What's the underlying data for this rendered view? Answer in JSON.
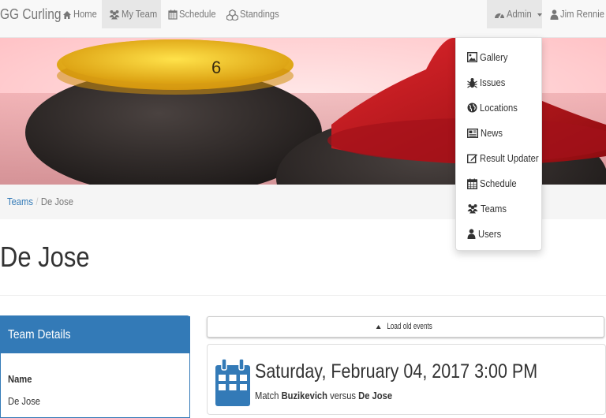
{
  "navbar": {
    "brand": "GG Curling",
    "items": [
      {
        "label": "Home",
        "icon": "home-icon"
      },
      {
        "label": "My Team",
        "icon": "users-icon",
        "active": true
      },
      {
        "label": "Schedule",
        "icon": "calendar-icon"
      },
      {
        "label": "Standings",
        "icon": "cubes-icon"
      }
    ],
    "admin": {
      "label": "Admin",
      "icon": "tachometer-icon"
    },
    "user": {
      "label": "Jim Rennie",
      "icon": "user-icon"
    }
  },
  "admin_menu": {
    "items": [
      {
        "label": "Gallery",
        "icon": "picture-icon"
      },
      {
        "label": "Issues",
        "icon": "bug-icon"
      },
      {
        "label": "Locations",
        "icon": "globe-icon"
      },
      {
        "label": "News",
        "icon": "newspaper-icon"
      },
      {
        "label": "Result Updater",
        "icon": "edit-icon"
      },
      {
        "label": "Schedule",
        "icon": "calendar-icon"
      },
      {
        "label": "Teams",
        "icon": "users-icon"
      },
      {
        "label": "Users",
        "icon": "user-icon"
      }
    ]
  },
  "hero": {
    "stone_number": "6"
  },
  "breadcrumb": {
    "parent": "Teams",
    "separator": "/",
    "current": "De Jose"
  },
  "page": {
    "title": "De Jose"
  },
  "team_details": {
    "heading": "Team Details",
    "name_label": "Name",
    "name_value": "De Jose"
  },
  "events": {
    "load_old_label": "Load old events",
    "items": [
      {
        "date": "Saturday, February 04, 2017 3:00 PM",
        "prefix": "Match",
        "team1": "Buzikevich",
        "versus": "versus",
        "team2": "De Jose"
      }
    ]
  },
  "colors": {
    "primary": "#337ab7",
    "navbar_bg": "#f8f8f8",
    "stone_yellow": "#f2c21b",
    "stone_red": "#c4161c"
  }
}
